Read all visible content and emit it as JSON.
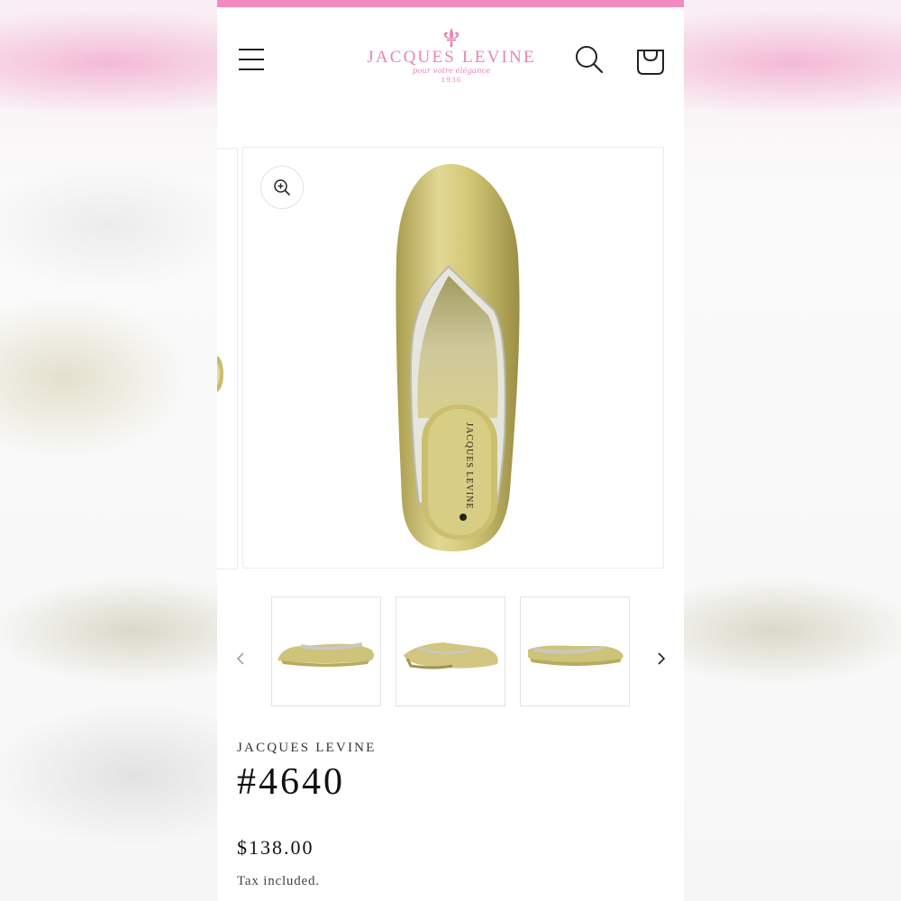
{
  "colors": {
    "accent": "#f48ac1",
    "logo": "#e884b8",
    "gold": "#c9bd6e",
    "silver": "#cfd1c8"
  },
  "header": {
    "menu_icon": "hamburger-menu-icon",
    "search_icon": "search-icon",
    "cart_icon": "cart-icon",
    "logo": {
      "name": "JACQUES LEVINE",
      "tagline": "pour votre élégance",
      "year": "1936"
    }
  },
  "gallery": {
    "zoom_icon": "zoom-in-icon",
    "main_image": "gold-leather-slipper-top-view",
    "thumbnails": [
      {
        "image": "gold-slipper-side-view"
      },
      {
        "image": "gold-slipper-angle-view"
      },
      {
        "image": "gold-slipper-side-view-right"
      }
    ],
    "prev_icon": "chevron-left-icon",
    "next_icon": "chevron-right-icon"
  },
  "product": {
    "vendor": "JACQUES LEVINE",
    "title": "#4640",
    "price": "$138.00",
    "tax_note": "Tax included."
  }
}
